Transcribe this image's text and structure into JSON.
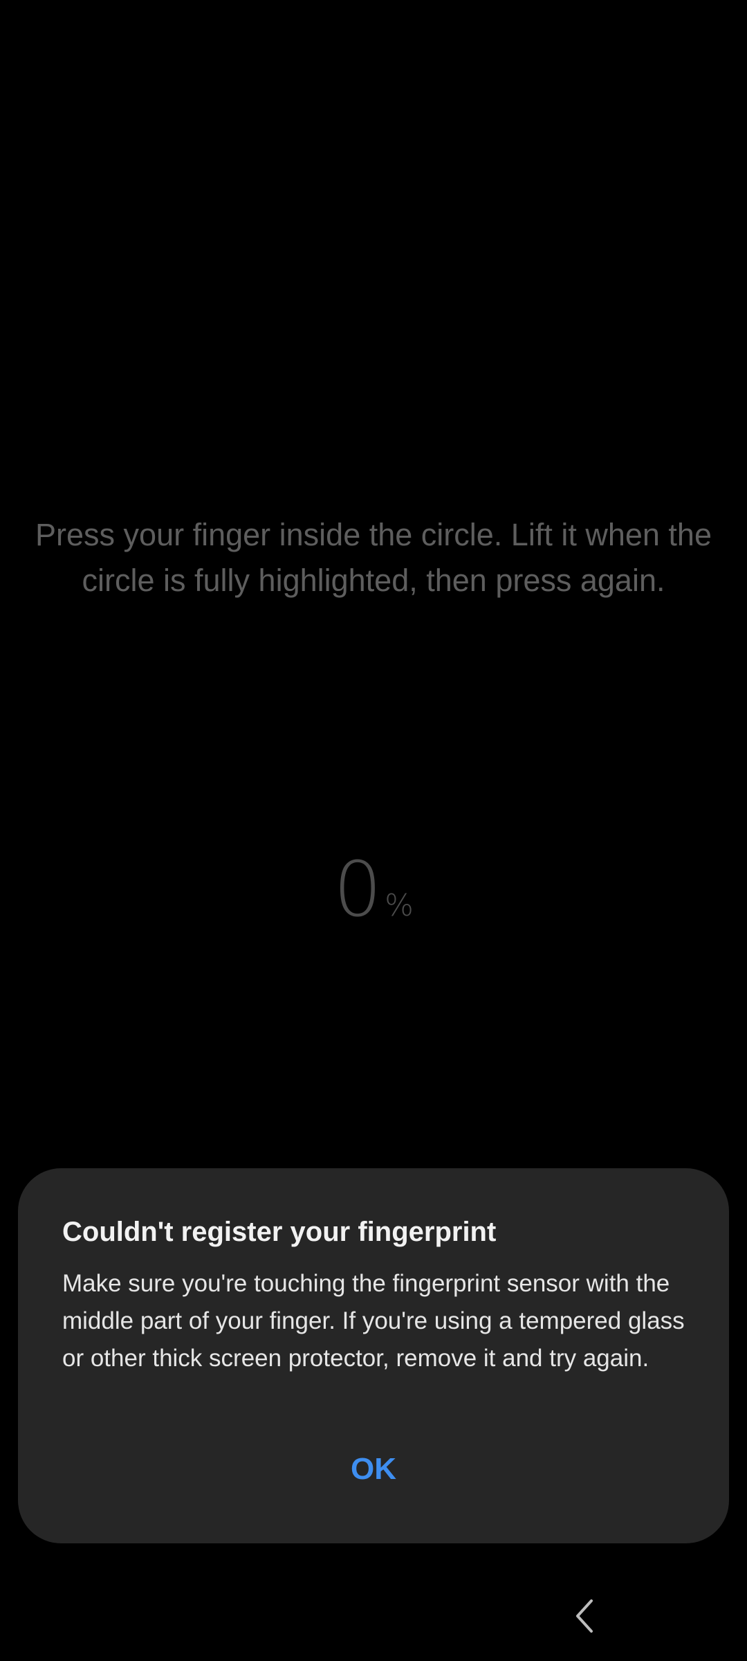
{
  "screen": {
    "instruction": "Press your finger inside the circle. Lift it when the circle is fully highlighted, then press again.",
    "progress": {
      "value": "0",
      "unit": "%"
    }
  },
  "dialog": {
    "title": "Couldn't register your fingerprint",
    "message": "Make sure you're touching the fingerprint sensor with the middle part of your finger. If you're using a tempered glass or other thick screen protector, remove it and try again.",
    "ok_label": "OK"
  },
  "navbar": {
    "back_icon": "chevron-left-icon"
  },
  "colors": {
    "background": "#000000",
    "dialog_background": "#262626",
    "accent": "#3e8ef0",
    "instruction_text": "#5e5e5e"
  }
}
